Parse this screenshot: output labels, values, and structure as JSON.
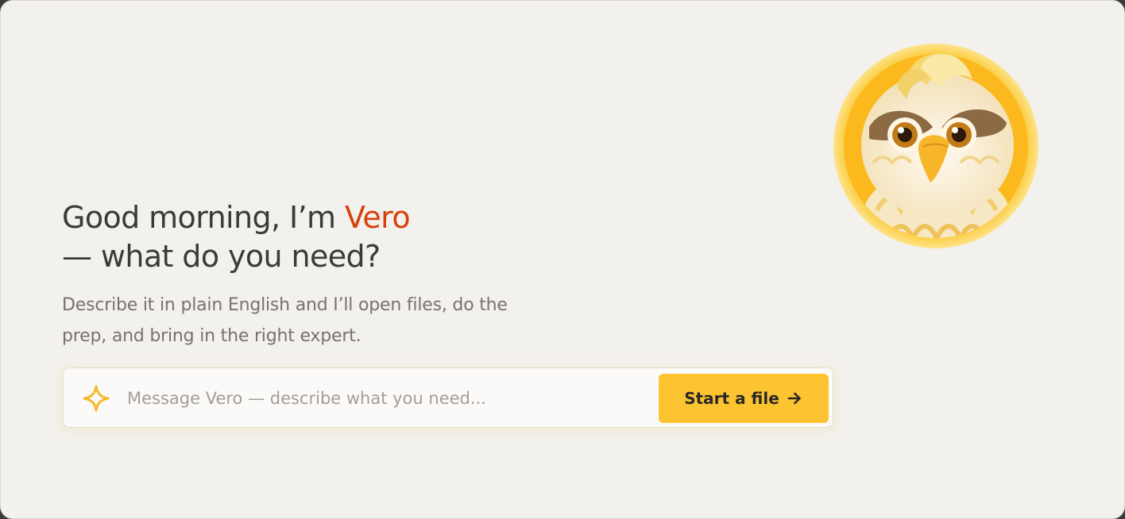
{
  "greeting": {
    "line1_prefix": "Good morning, I’m ",
    "assistant_name": "Vero",
    "line2": "— what do you need?"
  },
  "subtitle": "Describe it in plain English and I’ll open files, do the prep, and bring in the right expert.",
  "composer": {
    "icon": "sparkle-icon",
    "placeholder": "Message Vero — describe what you need...",
    "value": "",
    "button_label": "Start a file",
    "button_icon": "arrow-right-icon"
  },
  "avatar": {
    "description_icon": "owl-mascot-avatar"
  },
  "colors": {
    "background": "#f3f1ed",
    "accent_name": "#d6420d",
    "button": "#fdc431",
    "sparkle": "#f5b82a"
  }
}
